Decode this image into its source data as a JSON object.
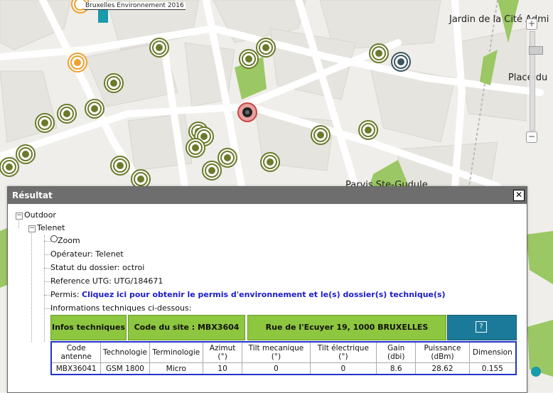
{
  "map": {
    "attribution": "Bruxelles Environnement 2016",
    "labels": {
      "jardin": "Jardin de la Cité Admi",
      "place": "Place du",
      "parvis": "Parvis Ste-Gudule"
    },
    "colors": {
      "road": "#ffffff",
      "block": "#e9e7e2",
      "park": "#9bc764",
      "antenna": "#6b7a2b",
      "selected": "#cc4444"
    }
  },
  "zoom": {
    "plus": "+",
    "minus": "−"
  },
  "panel": {
    "title": "Résultat",
    "close_label": "✕",
    "tree": {
      "outdoor": "Outdoor",
      "operator_node": "Telenet",
      "zoom": "Zoom",
      "operateur": "Opérateur: Telenet",
      "statut": "Statut du dossier: octroi",
      "reference": "Reference UTG: UTG/184671",
      "permis_label": "Permis: ",
      "permis_link": "Cliquez ici pour obtenir le permis d'environnement et le(s) dossier(s) technique(s)",
      "informations": "Informations techniques ci-dessous:"
    },
    "info_bar": {
      "infos": "Infos techniques",
      "code_site": "Code du site : MBX3604",
      "address": "Rue de l'Ecuyer 19, 1000 BRUXELLES",
      "help": "?"
    },
    "table": {
      "headers": [
        "Code antenne",
        "Technologie",
        "Terminologie",
        "Azimut (°)",
        "Tilt mecanique (°)",
        "Tilt électrique (°)",
        "Gain (dbi)",
        "Puissance (dBm)",
        "Dimension"
      ],
      "rows": [
        [
          "MBX36041",
          "GSM 1800",
          "Micro",
          "10",
          "0",
          "0",
          "8.6",
          "28.62",
          "0.155"
        ]
      ]
    }
  }
}
